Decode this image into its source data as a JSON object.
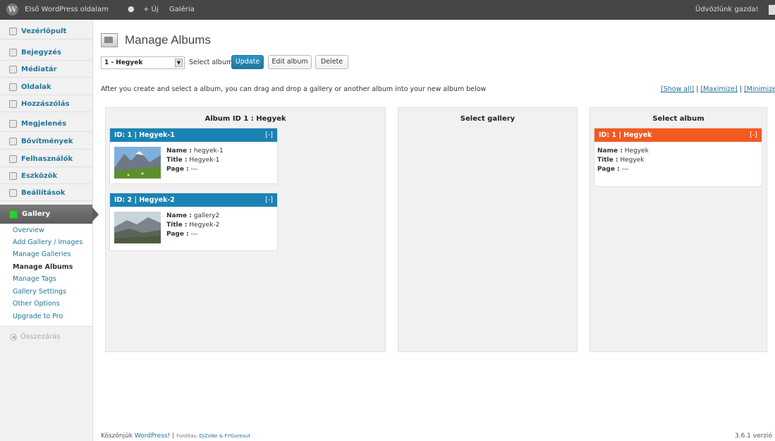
{
  "adminbar": {
    "site_name": "Első WordPress oldalam",
    "new_label": "+ Új",
    "gallery_label": "Galéria",
    "greeting": "Üdvözlünk gazda!"
  },
  "sidebar": {
    "items": [
      {
        "label": "Vezérlőpult"
      },
      {
        "label": "Bejegyzés"
      },
      {
        "label": "Médiatár"
      },
      {
        "label": "Oldalak"
      },
      {
        "label": "Hozzászólás"
      },
      {
        "label": "Megjelenés"
      },
      {
        "label": "Bővítmények"
      },
      {
        "label": "Felhasználók"
      },
      {
        "label": "Eszközök"
      },
      {
        "label": "Beállítások"
      }
    ],
    "gallery_label": "Gallery",
    "submenu": [
      {
        "label": "Overview"
      },
      {
        "label": "Add Gallery / Images"
      },
      {
        "label": "Manage Galleries"
      },
      {
        "label": "Manage Albums"
      },
      {
        "label": "Manage Tags"
      },
      {
        "label": "Gallery Settings"
      },
      {
        "label": "Other Options"
      },
      {
        "label": "Upgrade to Pro"
      }
    ],
    "collapse_label": "Összezárás"
  },
  "main": {
    "title": "Manage Albums",
    "album_select_value": "1 - Hegyek",
    "select_album_label": "Select album",
    "buttons": {
      "update": "Update",
      "edit": "Edit album",
      "delete": "Delete"
    },
    "info_text": "After you create and select a album, you can drag and drop a gallery or another album into your new album below",
    "toggles": {
      "show_all": "[Show all]",
      "maximize": "[Maximize]",
      "minimize": "[Minimize]",
      "sep": " | "
    }
  },
  "panels": {
    "album": {
      "title": "Album ID 1 : Hegyek",
      "cards": [
        {
          "head": "ID: 1 | Hegyek-1",
          "min": "[-]",
          "name_label": "Name :",
          "name": "hegyek-1",
          "title_label": "Title :",
          "title": "Hegyek-1",
          "page_label": "Page :",
          "page": "---"
        },
        {
          "head": "ID: 2 | Hegyek-2",
          "min": "[-]",
          "name_label": "Name :",
          "name": "gallery2",
          "title_label": "Title :",
          "title": "Hegyek-2",
          "page_label": "Page :",
          "page": "---"
        }
      ]
    },
    "gallery": {
      "title": "Select gallery"
    },
    "select_album": {
      "title": "Select album",
      "card": {
        "head": "ID: 1 | Hegyek",
        "min": "[-]",
        "name_label": "Name :",
        "name": "Hegyek",
        "title_label": "Title :",
        "title": "Hegyek",
        "page_label": "Page :",
        "page": "---"
      }
    }
  },
  "footer": {
    "thanks": "Köszönjük ",
    "wp_link": "WordPress",
    "excl": "! | ",
    "translation_label": "Fordítás: ",
    "translators": "DjZoNe & FYGureout",
    "version": "3.6.1 verzió"
  },
  "colors": {
    "gallery_card_head": "#1b83b3",
    "album_card_head": "#f35a21",
    "link": "#21759b",
    "adminbar": "#464646"
  }
}
